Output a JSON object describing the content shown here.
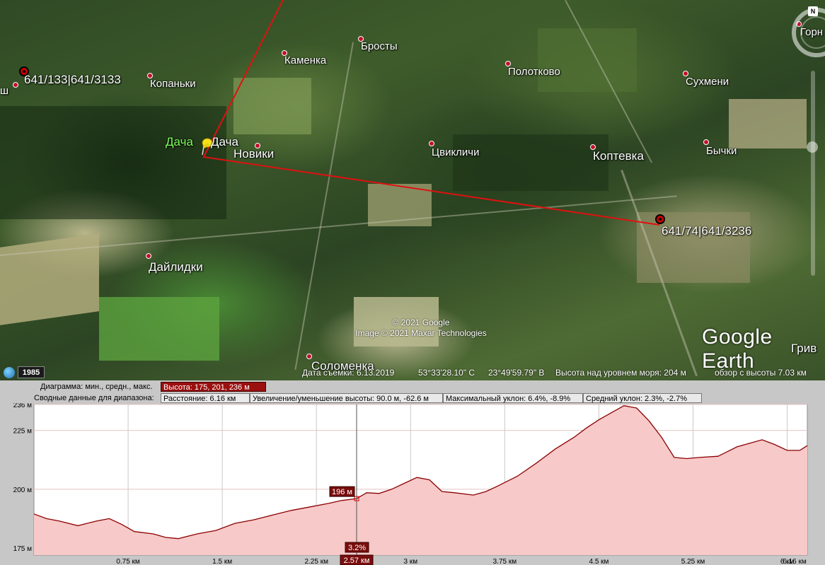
{
  "map": {
    "places": [
      {
        "name": "641/133|641/3133",
        "kind": "target"
      },
      {
        "name": "Копаньки",
        "kind": "dot"
      },
      {
        "name": "Каменка",
        "kind": "dot"
      },
      {
        "name": "Бросты",
        "kind": "dot"
      },
      {
        "name": "Полотково",
        "kind": "dot"
      },
      {
        "name": "Сухмени",
        "kind": "dot"
      },
      {
        "name": "Горн",
        "kind": "dot"
      },
      {
        "name": "Дача",
        "kind": "pin"
      },
      {
        "name": "Новики",
        "kind": "dot"
      },
      {
        "name": "Цвикличи",
        "kind": "dot"
      },
      {
        "name": "Коптевка",
        "kind": "dot"
      },
      {
        "name": "Бычки",
        "kind": "dot"
      },
      {
        "name": "641/74|641/3236",
        "kind": "target"
      },
      {
        "name": "Дайлидки",
        "kind": "dot"
      },
      {
        "name": "Соломенка",
        "kind": "dot"
      },
      {
        "name": "Грив",
        "kind": "none"
      },
      {
        "name": "ш",
        "kind": "none"
      }
    ],
    "placemark_label": "Дача",
    "copyright_lines": [
      "© 2021 Google",
      "Image © 2021 Maxar Technologies"
    ],
    "logo": "Google Earth",
    "compass_north": "N",
    "path_color": "#e01010"
  },
  "statusbar": {
    "year_button": "1985",
    "capture_date": "Дата съемки: 6.13.2019",
    "lat": "53°33'28.10\" С",
    "lon": "23°49'59.79\" В",
    "elevation": "Высота над уровнем моря:  204 м",
    "eye_alt": "обзор с высоты   7.03 км"
  },
  "profile": {
    "header_row1_label": "Диаграмма: мин., средн., макс.",
    "header_row1_value": "Высота: 175, 201, 236 м",
    "header_row2_label": "Сводные данные для диапазона:",
    "distance": "Расстояние: 6.16 км",
    "elev_change": "Увеличение/уменьшение высоты: 90.0 м, -62.6 м",
    "max_slope": "Максимальный уклон: 6.4%, -8.9%",
    "avg_slope": "Средний уклон: 2.3%, -2.7%",
    "cursor_value": "196 м",
    "cursor_slope": "3.2%",
    "cursor_distance": "2.57 км",
    "fill_color": "#f7c9c9",
    "line_color": "#8b0000"
  },
  "chart_data": {
    "type": "area",
    "xlabel": "",
    "ylabel": "",
    "xlim": [
      0,
      6.16
    ],
    "ylim": [
      172,
      236
    ],
    "x_ticks": [
      "0.75 км",
      "1.5 км",
      "2.25 км",
      "3 км",
      "3.75 км",
      "4.5 км",
      "5.25 км",
      "6 км",
      "6.16 км"
    ],
    "x_tick_values": [
      0.75,
      1.5,
      2.25,
      3.0,
      3.75,
      4.5,
      5.25,
      6.0,
      6.16
    ],
    "y_ticks": [
      "236 м",
      "225 м",
      "200 м",
      "175 м"
    ],
    "y_tick_values": [
      236,
      225,
      200,
      175
    ],
    "series": [
      {
        "x": [
          0,
          0.1,
          0.2,
          0.35,
          0.5,
          0.6,
          0.7,
          0.8,
          0.95,
          1.05,
          1.15,
          1.3,
          1.45,
          1.6,
          1.75,
          1.9,
          2.05,
          2.2,
          2.35,
          2.45,
          2.57,
          2.65,
          2.75,
          2.85,
          2.95,
          3.05,
          3.15,
          3.25,
          3.35,
          3.5,
          3.6,
          3.7,
          3.85,
          4.0,
          4.15,
          4.3,
          4.4,
          4.5,
          4.6,
          4.7,
          4.8,
          4.9,
          5.0,
          5.1,
          5.2,
          5.3,
          5.45,
          5.6,
          5.7,
          5.8,
          5.9,
          6.0,
          6.1,
          6.16
        ],
        "y": [
          189.5,
          187.5,
          186.5,
          184.5,
          186.5,
          187.5,
          185.0,
          182.0,
          181.0,
          179.5,
          179.0,
          181.0,
          182.5,
          185.5,
          187.0,
          189.0,
          191.0,
          192.5,
          194.0,
          195.2,
          196.0,
          198.5,
          198.2,
          200.0,
          202.5,
          205.0,
          204.0,
          199.0,
          198.5,
          197.5,
          199.0,
          201.5,
          205.5,
          211.0,
          217.0,
          222.0,
          226.0,
          229.5,
          232.5,
          235.5,
          234.5,
          229.0,
          222.0,
          213.5,
          213.0,
          213.5,
          214.0,
          218.0,
          219.5,
          221.0,
          219.0,
          216.5,
          216.5,
          218.5
        ]
      }
    ]
  }
}
